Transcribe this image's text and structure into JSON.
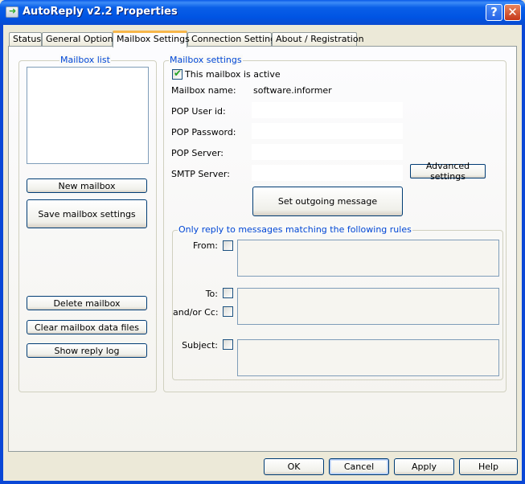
{
  "window": {
    "title": "AutoReply v2.2 Properties",
    "help_button": "?",
    "close_button": "✕"
  },
  "tabs": [
    {
      "label": "Status",
      "active": false
    },
    {
      "label": "General Options",
      "active": false
    },
    {
      "label": "Mailbox Settings",
      "active": true
    },
    {
      "label": "Connection Settings",
      "active": false
    },
    {
      "label": "About / Registration",
      "active": false
    }
  ],
  "mailbox_list": {
    "legend": "Mailbox list",
    "items": [],
    "buttons": {
      "new": "New mailbox",
      "save": "Save mailbox settings",
      "delete": "Delete mailbox",
      "clear": "Clear mailbox data files",
      "log": "Show reply log"
    }
  },
  "mailbox_settings": {
    "legend": "Mailbox settings",
    "active_checkbox": {
      "label": "This mailbox is active",
      "checked": true
    },
    "fields": {
      "mailbox_name": {
        "label": "Mailbox name:",
        "value": "software.informer"
      },
      "pop_user": {
        "label": "POP User id:",
        "value": ""
      },
      "pop_password": {
        "label": "POP Password:",
        "value": ""
      },
      "pop_server": {
        "label": "POP Server:",
        "value": ""
      },
      "smtp_server": {
        "label": "SMTP Server:",
        "value": ""
      }
    },
    "advanced_button": "Advanced settings",
    "outgoing_button": "Set outgoing message"
  },
  "rules": {
    "legend": "Only reply to messages matching the following rules",
    "from": {
      "label": "From:",
      "checked": false,
      "value": ""
    },
    "to": {
      "label": "To:",
      "checked": false
    },
    "cc": {
      "label": "and/or Cc:",
      "checked": false
    },
    "to_cc_value": "",
    "subject": {
      "label": "Subject:",
      "checked": false,
      "value": ""
    }
  },
  "footer": {
    "ok": "OK",
    "cancel": "Cancel",
    "apply": "Apply",
    "help": "Help"
  }
}
